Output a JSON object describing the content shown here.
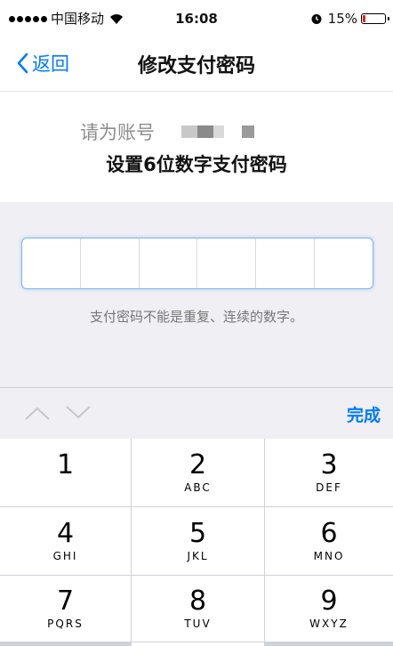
{
  "status_bar": {
    "carrier": "中国移动",
    "time": "16:08",
    "battery_percent": "15%",
    "battery_level": 0.15,
    "battery_color": "#e2231a"
  },
  "nav": {
    "back_label": "返回",
    "title": "修改支付密码"
  },
  "header": {
    "account_prefix": "请为账号",
    "setup_title": "设置6位数字支付密码"
  },
  "pin": {
    "cells": [
      "",
      "",
      "",
      "",
      "",
      ""
    ],
    "hint": "支付密码不能是重复、连续的数字。"
  },
  "accessory": {
    "done_label": "完成"
  },
  "keypad": {
    "keys": [
      {
        "digit": "1",
        "letters": ""
      },
      {
        "digit": "2",
        "letters": "ABC"
      },
      {
        "digit": "3",
        "letters": "DEF"
      },
      {
        "digit": "4",
        "letters": "GHI"
      },
      {
        "digit": "5",
        "letters": "JKL"
      },
      {
        "digit": "6",
        "letters": "MNO"
      },
      {
        "digit": "7",
        "letters": "PQRS"
      },
      {
        "digit": "8",
        "letters": "TUV"
      },
      {
        "digit": "9",
        "letters": "WXYZ"
      }
    ]
  },
  "colors": {
    "accent": "#007aff",
    "background_gray": "#efeff4"
  }
}
